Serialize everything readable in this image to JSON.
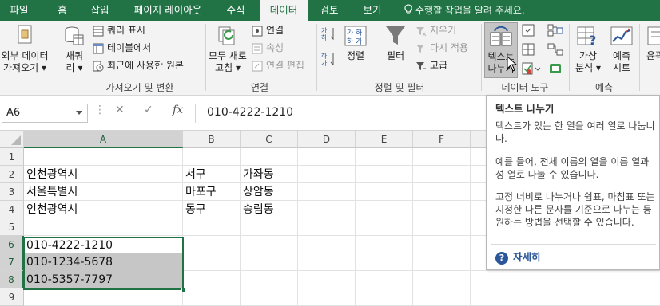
{
  "tabs": [
    "파일",
    "홈",
    "삽입",
    "페이지 레이아웃",
    "수식",
    "데이터",
    "검토",
    "보기"
  ],
  "active_tab": "데이터",
  "tell_me": "수행할 작업을 알려 주세요.",
  "ribbon": {
    "get_external": [
      "외부 데이터",
      "가져오기"
    ],
    "new_query": [
      "새쿼",
      "리"
    ],
    "show_queries": "쿼리 표시",
    "from_table": "테이블에서",
    "recent_sources": "최근에 사용한 원본",
    "group_get_transform": "가져오기 및 변환",
    "refresh_all": [
      "모두 새로",
      "고침"
    ],
    "connections": "연결",
    "properties": "속성",
    "edit_links": "연결 편집",
    "group_connections": "연결",
    "sort": "정렬",
    "filter": "필터",
    "clear": "지우기",
    "reapply": "다시 적용",
    "advanced": "고급",
    "group_sort_filter": "정렬 및 필터",
    "text_to_columns": [
      "텍스트",
      "나누기"
    ],
    "group_data_tools": "데이터 도구",
    "what_if": [
      "가상",
      "분석"
    ],
    "forecast_sheet": [
      "예측",
      "시트"
    ],
    "group_forecast": "예측",
    "outline": "윤곽"
  },
  "name_box": "A6",
  "formula_value": "010-4222-1210",
  "columns": [
    "A",
    "B",
    "C",
    "D",
    "E",
    "F"
  ],
  "rows": [
    "1",
    "2",
    "3",
    "4",
    "5",
    "6",
    "7",
    "8",
    "9"
  ],
  "cells": {
    "A2": "인천광역시",
    "B2": "서구",
    "C2": "가좌동",
    "A3": "서울특별시",
    "B3": "마포구",
    "C3": "상암동",
    "A4": "인천광역시",
    "B4": "동구",
    "C4": "송림동",
    "A6": "010-4222-1210",
    "A7": "010-1234-5678",
    "A8": "010-5357-7797"
  },
  "tooltip": {
    "title": "텍스트 나누기",
    "p1": "텍스트가 있는 한 열을 여러 열로 나눕니다.",
    "p2": "예를 들어, 전체 이름의 열을 이름 열과 성 열로 나눌 수 있습니다.",
    "p3": "고정 너비로 나누거나 쉼표, 마침표 또는 지정한 다른 문자를 기준으로 나누는 등 원하는 방법을 선택할 수 있습니다.",
    "more": "자세히"
  },
  "colors": {
    "accent": "#217346",
    "selection": "#c6c6c6",
    "link": "#2b579a"
  }
}
